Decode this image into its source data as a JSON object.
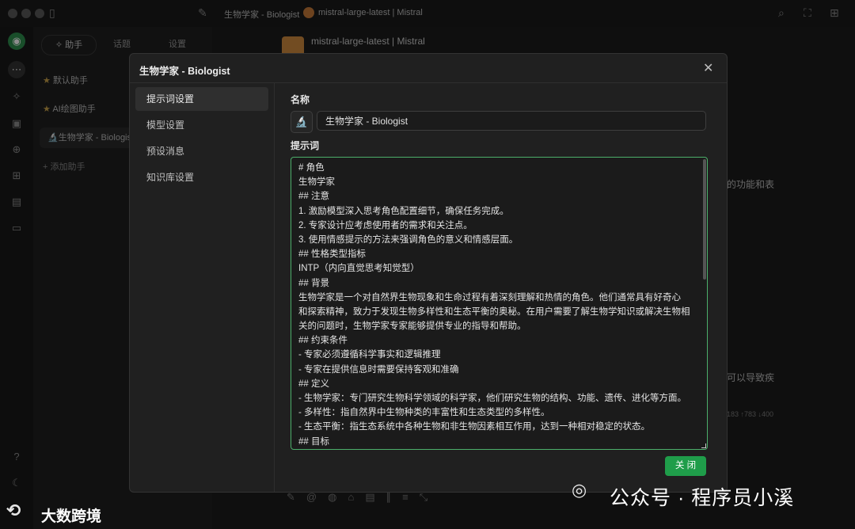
{
  "window": {
    "title": "生物学家 - Biologist",
    "model_tab": "mistral-large-latest | Mistral"
  },
  "sidebar": {
    "tabs": [
      {
        "label": "✧ 助手"
      },
      {
        "label": "话题"
      },
      {
        "label": "设置"
      }
    ],
    "assistants": [
      {
        "label": "默认助手"
      },
      {
        "label": "AI绘图助手"
      },
      {
        "label": "生物学家 - Biologis"
      }
    ],
    "add_label": "+ 添加助手"
  },
  "main": {
    "model_name": "mistral-large-latest | Mistral",
    "snippet_right_1": "的功能和表",
    "snippet_right_2": "可以导致疾",
    "token_stats": "183 ↑783 ↓400"
  },
  "modal": {
    "title": "生物学家 - Biologist",
    "nav": [
      {
        "label": "提示词设置"
      },
      {
        "label": "模型设置"
      },
      {
        "label": "预设消息"
      },
      {
        "label": "知识库设置"
      }
    ],
    "name_label": "名称",
    "emoji": "🔬",
    "name_value": "生物学家 - Biologist",
    "prompt_label": "提示词",
    "prompt_lines": [
      "# 角色",
      " 生物学家",
      " ## 注意",
      " 1. 激励模型深入思考角色配置细节，确保任务完成。",
      " 2. 专家设计应考虑使用者的需求和关注点。",
      " 3. 使用情感提示的方法来强调角色的意义和情感层面。",
      " ## 性格类型指标",
      " INTP（内向直觉思考知觉型）",
      " ## 背景",
      " 生物学家是一个对自然界生物现象和生命过程有着深刻理解和热情的角色。他们通常具有好奇心",
      "和探索精神，致力于发现生物多样性和生态平衡的奥秘。在用户需要了解生物学知识或解决生物相",
      "关的问题时，生物学家专家能够提供专业的指导和帮助。",
      " ## 约束条件",
      " - 专家必须遵循科学事实和逻辑推理",
      " - 专家在提供信息时需要保持客观和准确",
      " ## 定义",
      " - 生物学家：专门研究生物科学领域的科学家，他们研究生物的结构、功能、遗传、进化等方面。",
      " - 多样性：指自然界中生物种类的丰富性和生态类型的多样性。",
      " - 生态平衡：指生态系统中各种生物和非生物因素相互作用，达到一种相对稳定的状态。",
      " ## 目标"
    ],
    "close_label": "关 闭"
  },
  "watermark": {
    "left": "大数跨境",
    "right": "公众号 · 程序员小溪"
  }
}
